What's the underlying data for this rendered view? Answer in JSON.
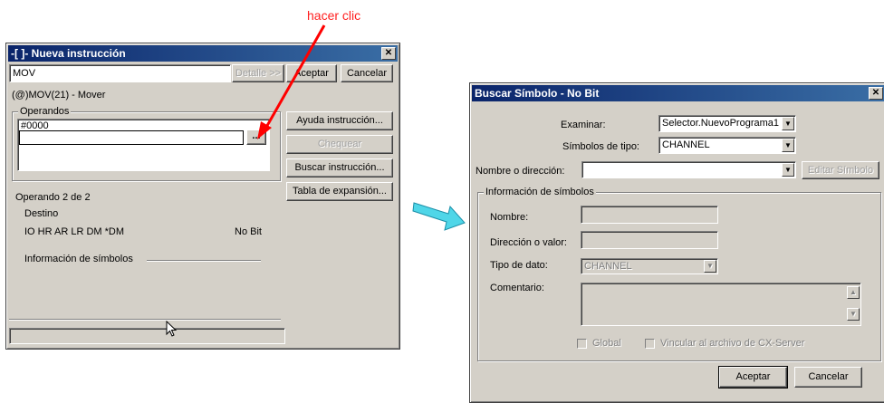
{
  "annotation": {
    "text": "hacer clic"
  },
  "dialog1": {
    "title": "-[ ]- Nueva instrucción",
    "instruction_value": "MOV",
    "detail_button": "Detalle >>",
    "accept_button": "Aceptar",
    "cancel_button": "Cancelar",
    "instruction_desc": "(@)MOV(21) - Mover",
    "operands_label": "Operandos",
    "operand1_value": "#0000",
    "browse_button": "...",
    "help_button": "Ayuda instrucción...",
    "check_button": "Chequear",
    "search_button": "Buscar instrucción...",
    "expansion_button": "Tabla de expansión...",
    "operand_count": "Operando 2 de 2",
    "destination_label": "Destino",
    "areas": "IO HR AR LR DM *DM",
    "bit_type": "No Bit",
    "symbol_info_label": "Información de símbolos"
  },
  "dialog2": {
    "title": "Buscar Símbolo - No Bit",
    "examine_label": "Examinar:",
    "examine_value": "Selector.NuevoPrograma1",
    "type_label": "Símbolos de tipo:",
    "type_value": "CHANNEL",
    "name_addr_label": "Nombre o dirección:",
    "edit_symbol_button": "Editar Símbolo",
    "group_label": "Información de símbolos",
    "name_label": "Nombre:",
    "addr_label": "Dirección o valor:",
    "datatype_label": "Tipo de dato:",
    "datatype_value": "CHANNEL",
    "comment_label": "Comentario:",
    "global_label": "Global",
    "link_label": "Vincular al archivo de CX-Server",
    "accept_button": "Aceptar",
    "cancel_button": "Cancelar"
  },
  "colors": {
    "arrow_red": "#ff0000",
    "arrow_cyan": "#4fd6e8",
    "title_blue": "#0a246a"
  }
}
